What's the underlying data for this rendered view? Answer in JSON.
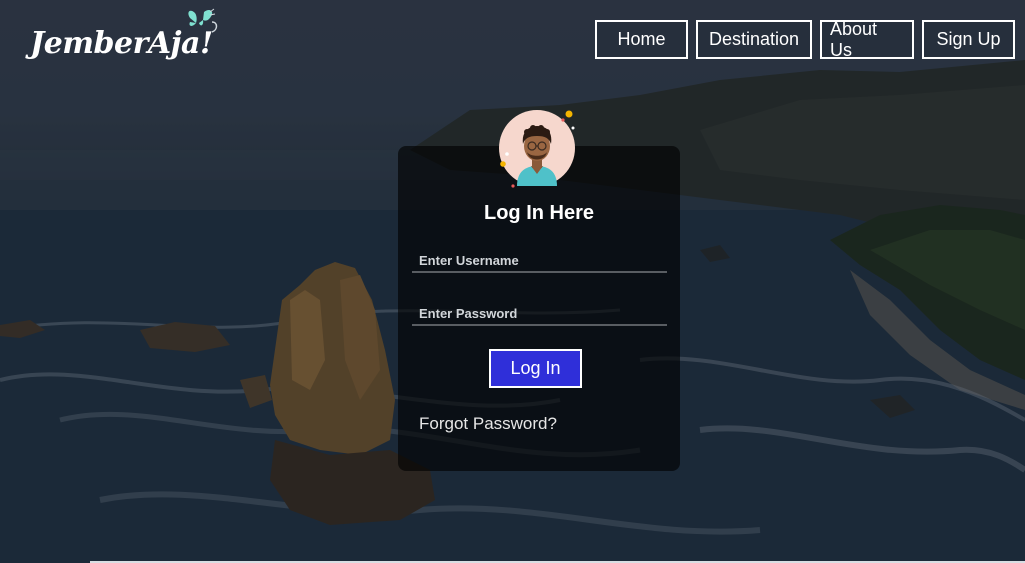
{
  "brand": {
    "logo_text": "JemberAja!",
    "logo_icon": "butterfly-icon"
  },
  "nav": {
    "items": [
      {
        "label": "Home"
      },
      {
        "label": "Destination"
      },
      {
        "label": "About Us"
      },
      {
        "label": "Sign Up"
      }
    ]
  },
  "login": {
    "avatar_icon": "user-avatar-icon",
    "title": "Log In Here",
    "username_placeholder": "Enter Username",
    "password_placeholder": "Enter Password",
    "button_label": "Log In",
    "forgot_label": "Forgot Password?"
  },
  "colors": {
    "button_bg": "#2f2fd9",
    "card_bg": "rgba(0,0,0,0.62)",
    "text": "#ffffff",
    "logo_accent": "#7fe0d0"
  }
}
